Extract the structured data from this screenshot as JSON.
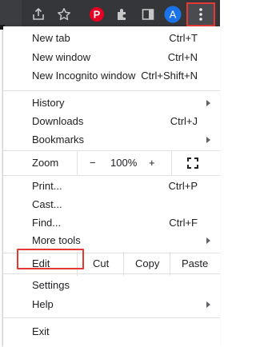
{
  "toolbar": {
    "icons": [
      "share-icon",
      "star-icon",
      "pinterest-icon",
      "extensions-icon",
      "side-panel-icon",
      "profile-avatar",
      "kebab-menu-icon"
    ],
    "profile_letter": "A",
    "pinterest_letter": "P",
    "brand_colors": {
      "pinterest": "#e60023",
      "avatar": "#1a73e8",
      "highlight": "#e53935"
    }
  },
  "menu": {
    "new_tab": {
      "label": "New tab",
      "shortcut": "Ctrl+T"
    },
    "new_window": {
      "label": "New window",
      "shortcut": "Ctrl+N"
    },
    "new_incognito": {
      "label": "New Incognito window",
      "shortcut": "Ctrl+Shift+N"
    },
    "history": {
      "label": "History"
    },
    "downloads": {
      "label": "Downloads",
      "shortcut": "Ctrl+J"
    },
    "bookmarks": {
      "label": "Bookmarks"
    },
    "zoom": {
      "label": "Zoom",
      "minus": "−",
      "value": "100%",
      "plus": "+"
    },
    "print": {
      "label": "Print...",
      "shortcut": "Ctrl+P"
    },
    "cast": {
      "label": "Cast..."
    },
    "find": {
      "label": "Find...",
      "shortcut": "Ctrl+F"
    },
    "more_tools": {
      "label": "More tools"
    },
    "edit": {
      "label": "Edit",
      "cut": "Cut",
      "copy": "Copy",
      "paste": "Paste"
    },
    "settings": {
      "label": "Settings"
    },
    "help": {
      "label": "Help"
    },
    "exit": {
      "label": "Exit"
    }
  }
}
